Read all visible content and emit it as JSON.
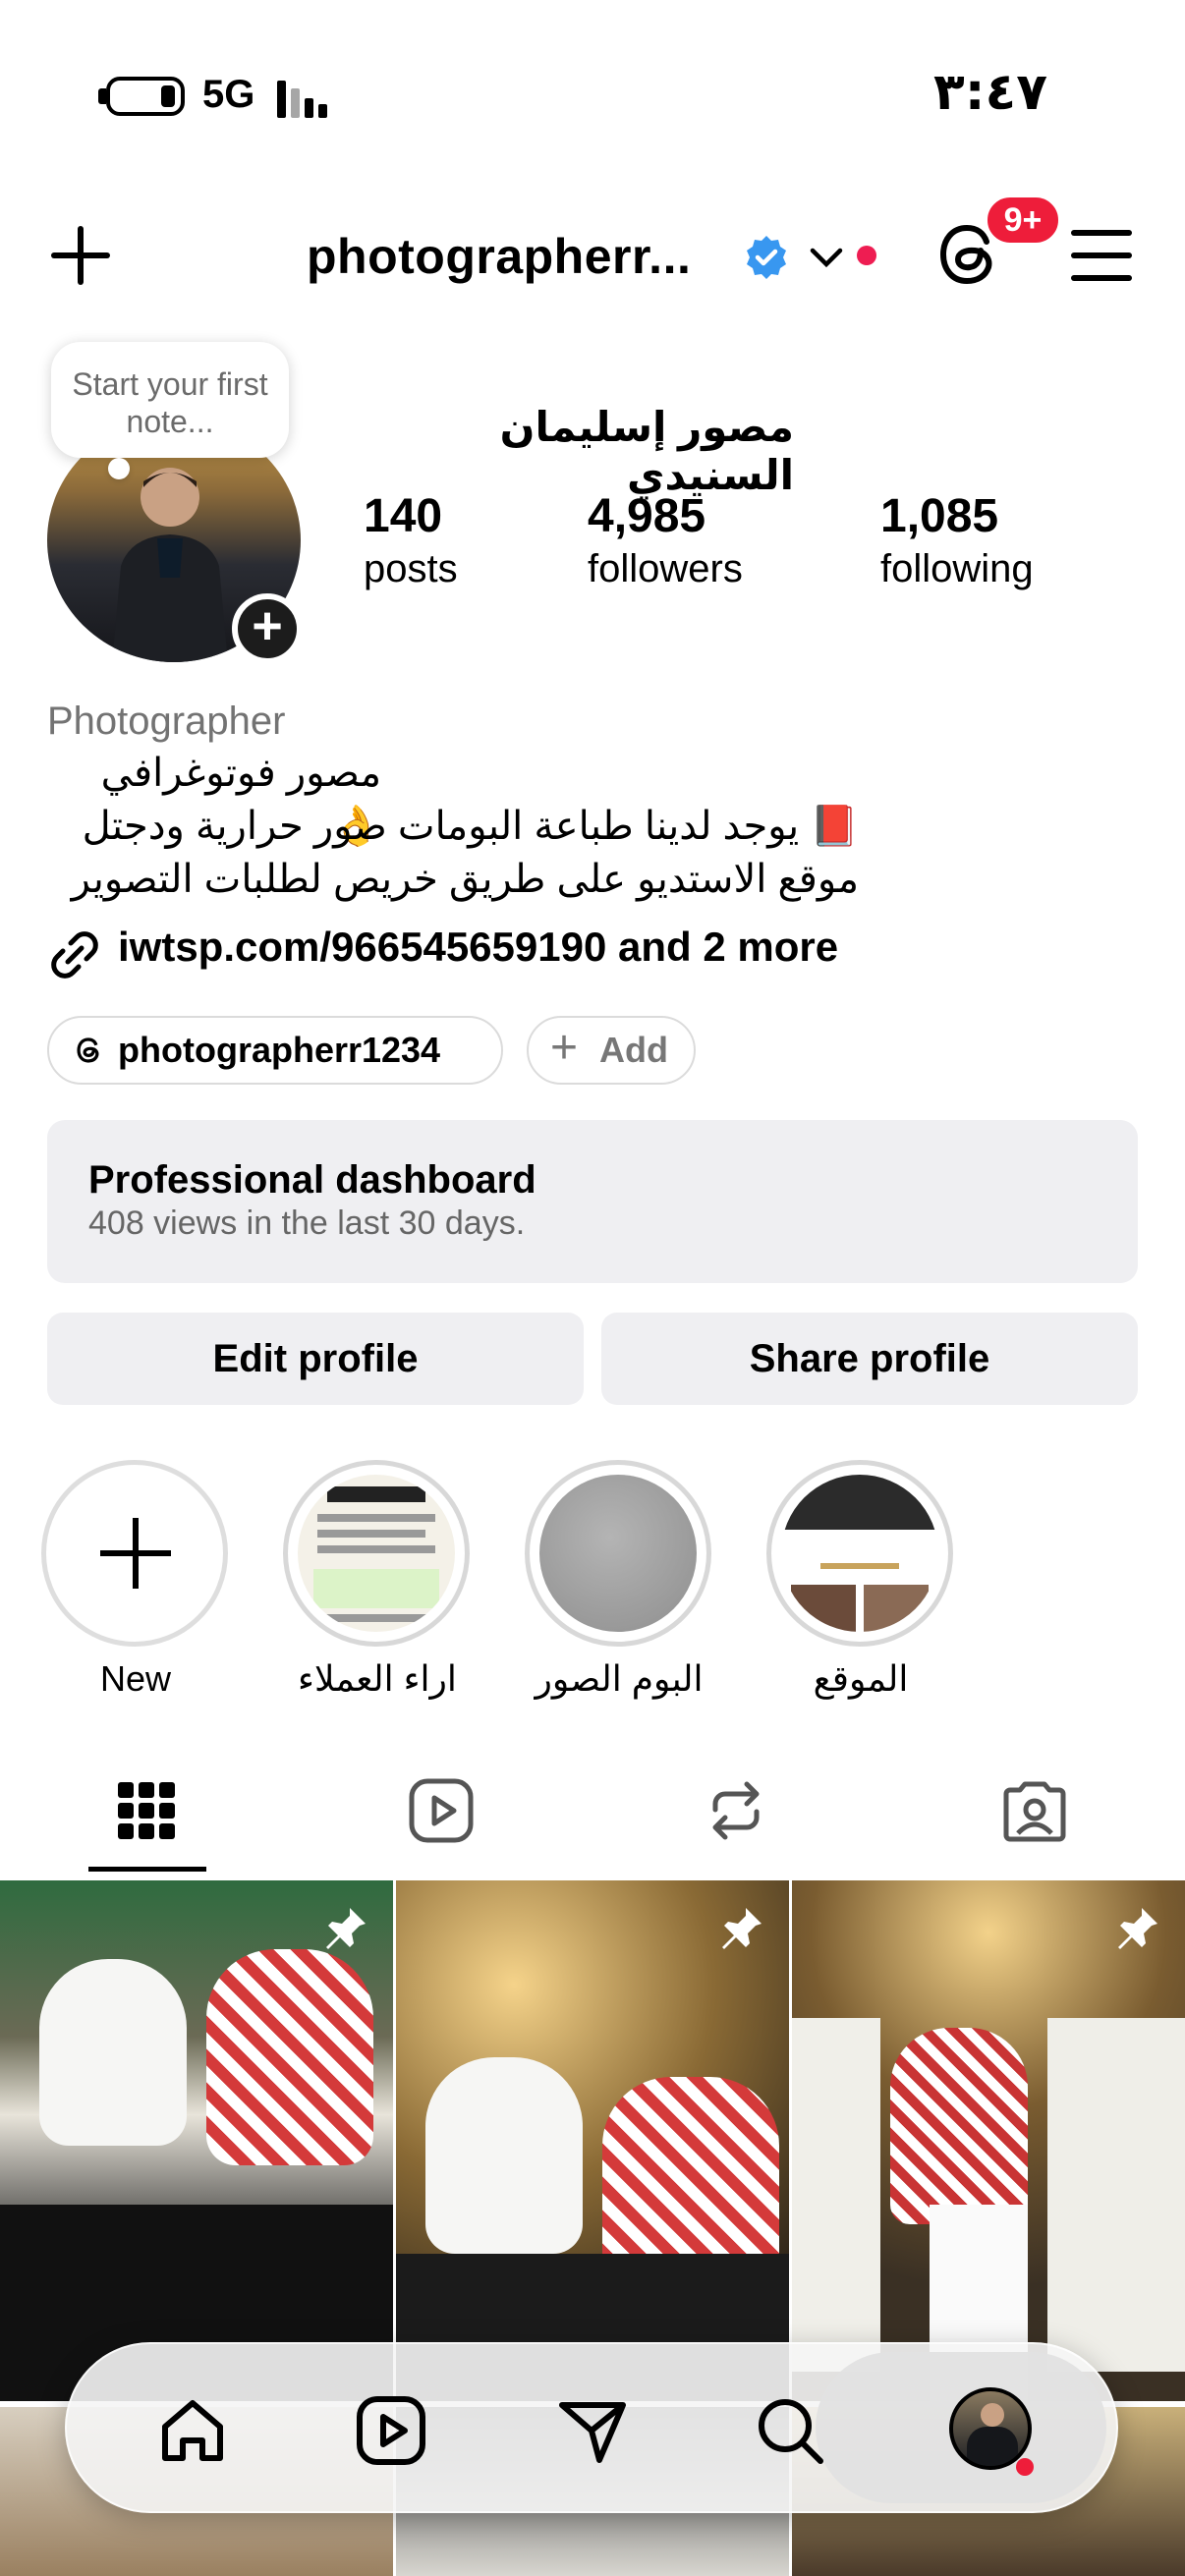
{
  "status_bar": {
    "network": "5G",
    "time": "٣:٤٧"
  },
  "header": {
    "username": "photographerr...",
    "notification_badge": "9+"
  },
  "profile": {
    "note": "Start your first note...",
    "full_name": "مصور إسليمان السنيدي",
    "stats": [
      {
        "value": "140",
        "label": "posts"
      },
      {
        "value": "4,985",
        "label": "followers"
      },
      {
        "value": "1,085",
        "label": "following"
      }
    ],
    "category": "Photographer",
    "bio_lines": [
      "مصور فوتوغرافي 👌",
      "📕 يوجد لدينا طباعة البومات صور حرارية ودجتل",
      "موقع الاستديو على طريق خريص لطلبات التصوير"
    ],
    "link": "iwtsp.com/966545659190 and 2 more",
    "threads_handle": "photographerr1234",
    "add_label": "Add"
  },
  "dashboard": {
    "title": "Professional dashboard",
    "subtitle": "408 views in the last 30 days."
  },
  "buttons": {
    "edit": "Edit profile",
    "share": "Share profile"
  },
  "highlights": [
    {
      "label": "New"
    },
    {
      "label": "اراء العملاء"
    },
    {
      "label": "البوم الصور"
    },
    {
      "label": "الموقع"
    }
  ],
  "tabs": [
    "grid-icon",
    "reels-icon",
    "reposts-icon",
    "tagged-icon"
  ],
  "colors": {
    "accent_red": "#ee1d3a",
    "verified_blue": "#3897f0",
    "panel_gray": "#efeff2"
  }
}
